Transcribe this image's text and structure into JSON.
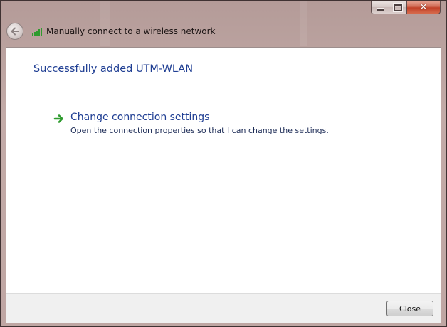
{
  "window": {
    "nav_title": "Manually connect to a wireless network",
    "controls": {
      "minimize_icon": "minimize-icon",
      "maximize_icon": "maximize-icon",
      "close_glyph": "✕"
    }
  },
  "main": {
    "heading": "Successfully added UTM-WLAN",
    "option": {
      "title": "Change connection settings",
      "description": "Open the connection properties so that I can change the settings.",
      "icon": "green-arrow-icon"
    }
  },
  "footer": {
    "close_label": "Close"
  },
  "colors": {
    "heading": "#1f3e93",
    "arrow": "#2e9b2e",
    "frame": "#bfa6a3"
  }
}
